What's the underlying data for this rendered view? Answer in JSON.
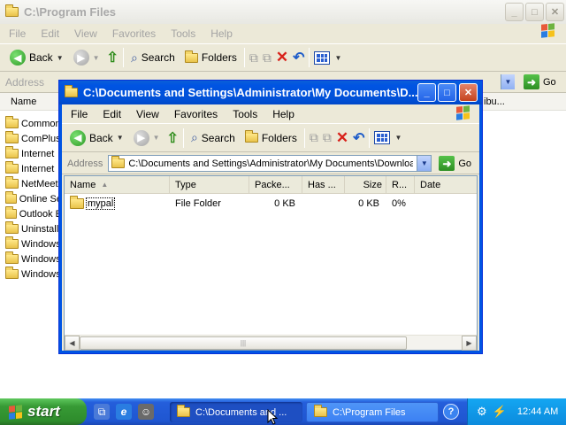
{
  "back_window": {
    "title": "C:\\Program Files",
    "menu": [
      "File",
      "Edit",
      "View",
      "Favorites",
      "Tools",
      "Help"
    ],
    "toolbar": {
      "back": "Back",
      "search": "Search",
      "folders": "Folders"
    },
    "address_label": "Address",
    "go_label": "Go",
    "list_header": "Name",
    "list_items": [
      "Common",
      "ComPlus",
      "Internet",
      "Internet",
      "NetMeeti",
      "Online Se",
      "Outlook E",
      "Uninstall",
      "Windows",
      "Windows",
      "Windows"
    ],
    "right_column_header": "ibu..."
  },
  "front_window": {
    "title": "C:\\Documents and Settings\\Administrator\\My Documents\\D...",
    "menu": [
      "File",
      "Edit",
      "View",
      "Favorites",
      "Tools",
      "Help"
    ],
    "toolbar": {
      "back": "Back",
      "search": "Search",
      "folders": "Folders"
    },
    "address": {
      "label": "Address",
      "value": "C:\\Documents and Settings\\Administrator\\My Documents\\Download",
      "go_label": "Go"
    },
    "columns": [
      "Name",
      "Type",
      "Packe...",
      "Has ...",
      "Size",
      "R...",
      "Date"
    ],
    "rows": [
      {
        "name": "mypal",
        "type": "File Folder",
        "packed": "0 KB",
        "has": "",
        "size": "0 KB",
        "ratio": "0%",
        "date": ""
      }
    ]
  },
  "taskbar": {
    "start_label": "start",
    "tasks": [
      {
        "label": "C:\\Documents and ...",
        "active": true
      },
      {
        "label": "C:\\Program Files",
        "active": false
      }
    ],
    "clock": "12:44 AM"
  },
  "colors": {
    "title_active": "#0054e3",
    "taskbar": "#245edb",
    "start": "#379a35",
    "tray": "#0c8bdd",
    "chrome": "#ece9d8"
  }
}
